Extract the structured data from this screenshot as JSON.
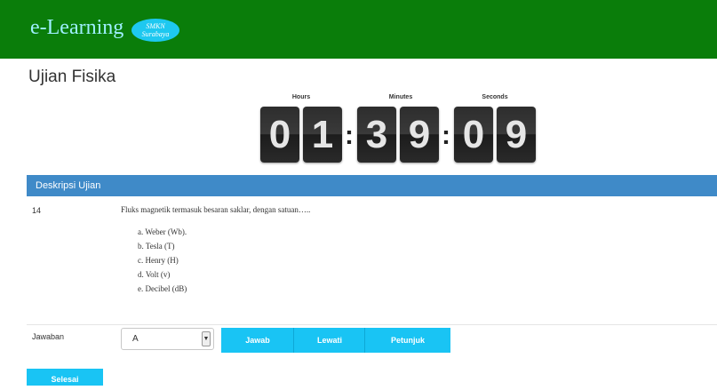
{
  "header": {
    "brand": "e-Learning",
    "badge_line1": "SMKN",
    "badge_line2": "Surabaya",
    "bg_color": "#0a7d0a"
  },
  "page": {
    "title": "Ujian Fisika"
  },
  "timer": {
    "hours_label": "Hours",
    "minutes_label": "Minutes",
    "seconds_label": "Seconds",
    "hours": [
      "0",
      "1"
    ],
    "minutes": [
      "3",
      "9"
    ],
    "seconds": [
      "0",
      "9"
    ],
    "separator": ":"
  },
  "panel": {
    "header": "Deskripsi Ujian",
    "header_color": "#3f8ac8"
  },
  "question": {
    "number": "14",
    "text": "Fluks magnetik termasuk besaran saklar, dengan satuan…..",
    "options": [
      "a. Weber (Wb).",
      "b. Tesla (T)",
      "c. Henry (H)",
      "d. Volt (v)",
      "e. Decibel (dB)"
    ]
  },
  "answer": {
    "label": "Jawaban",
    "selected": "A",
    "arrow_icon": "chevron-down-icon"
  },
  "buttons": {
    "jawab": "Jawab",
    "lewati": "Lewati",
    "petunjuk": "Petunjuk",
    "selesai": "Selesai",
    "color": "#19c4f4"
  }
}
